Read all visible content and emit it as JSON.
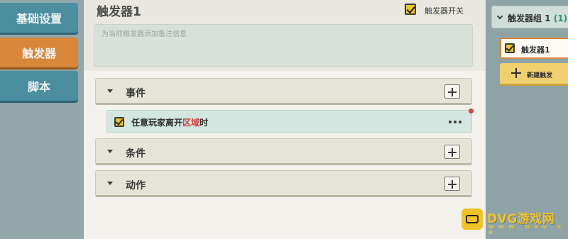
{
  "left_tabs": [
    {
      "label": "基础设置",
      "active": false
    },
    {
      "label": "触发器",
      "active": true
    },
    {
      "label": "脚本",
      "active": false
    }
  ],
  "trigger": {
    "title": "触发器1",
    "switch_label": "触发器开关",
    "switch_on": true,
    "note_placeholder": "为当前触发器添加备注信息"
  },
  "sections": {
    "events_label": "事件",
    "conditions_label": "条件",
    "actions_label": "动作"
  },
  "event_item": {
    "checked": true,
    "text_before": "任意玩家离开",
    "text_highlight": "区域",
    "text_after": "时"
  },
  "group_panel": {
    "group_name": "触发器组 1",
    "group_count": "(1)",
    "item_label": "触发器1",
    "new_label": "新建触发"
  },
  "watermark": {
    "text": "DVG游戏网",
    "sub": "W W W . D V G . C N"
  },
  "colors": {
    "active_tab": "#d7863a",
    "tab": "#4a8ea0",
    "check": "#f0c330",
    "highlight": "#d23b3b"
  }
}
